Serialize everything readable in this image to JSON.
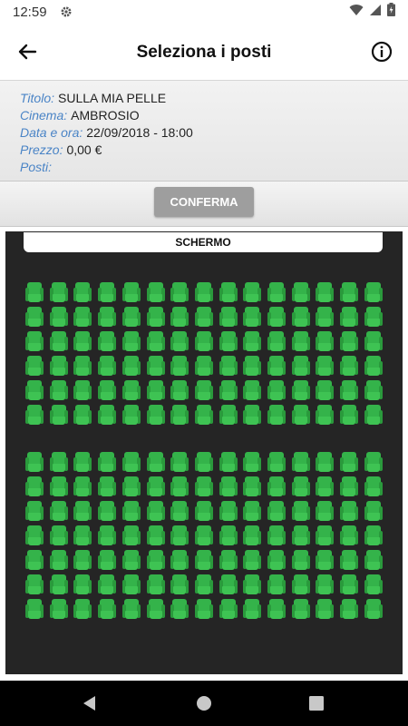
{
  "status_bar": {
    "time": "12:59",
    "icons": [
      "gear-icon",
      "wifi-icon",
      "signal-icon",
      "battery-icon"
    ]
  },
  "app_bar": {
    "title": "Seleziona i posti",
    "back_icon": "arrow-left-icon",
    "info_icon": "info-icon"
  },
  "details": [
    {
      "label": "Titolo:",
      "value": "SULLA MIA PELLE"
    },
    {
      "label": "Cinema:",
      "value": "AMBROSIO"
    },
    {
      "label": "Data e ora:",
      "value": "22/09/2018 - 18:00"
    },
    {
      "label": "Prezzo:",
      "value": "0,00 €"
    },
    {
      "label": "Posti:",
      "value": ""
    }
  ],
  "confirm": {
    "label": "CONFERMA"
  },
  "hall": {
    "screen_label": "SCHERMO",
    "blocks": [
      {
        "rows": 6,
        "seats_per_row": 15
      },
      {
        "rows": 7,
        "seats_per_row": 15
      }
    ],
    "seat_status": "available",
    "seat_color": "#34b34a",
    "background": "#252525"
  },
  "nav_bar": {
    "icons": [
      "back-triangle-icon",
      "home-circle-icon",
      "recents-square-icon"
    ]
  },
  "colors": {
    "label_accent": "#4a84c6",
    "button_disabled": "#9e9e9e"
  }
}
